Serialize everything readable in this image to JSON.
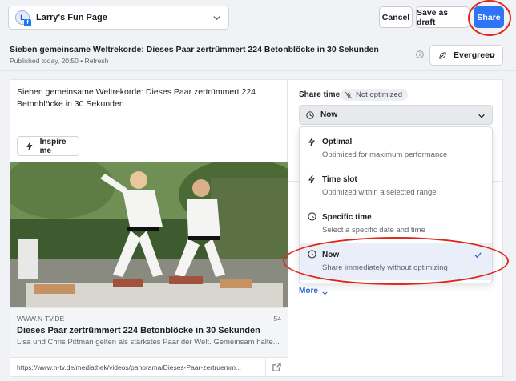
{
  "header": {
    "page_name": "Larry's Fun Page",
    "avatar_letter": "L",
    "cancel_label": "Cancel",
    "draft_label": "Save as draft",
    "share_label": "Share"
  },
  "post": {
    "title": "Sieben gemeinsame Weltrekorde: Dieses Paar zertrümmert 224 Betonblöcke in 30 Sekunden",
    "meta": "Published today, 20:50 • Refresh",
    "evergreen_label": "Evergreen",
    "body_text": "Sieben gemeinsame Weltrekorde: Dieses Paar zertrümmert 224 Betonblöcke in 30 Sekunden",
    "inspire_label": "Inspire me"
  },
  "link_card": {
    "domain": "WWW.N-TV.DE",
    "count": "54",
    "title": "Dieses Paar zertrümmert 224 Betonblöcke in 30 Sekunden",
    "description": "Lisa und Chris Pittman gelten als stärkstes Paar der Welt. Gemeinsam halte...",
    "url": "https://www.n-tv.de/mediathek/videos/panorama/Dieses-Paar-zertruemm..."
  },
  "share_time": {
    "label": "Share time",
    "badge": "Not optimized",
    "selected": "Now",
    "options": [
      {
        "title": "Optimal",
        "desc": "Optimized for maximum performance",
        "icon": "bolt-icon"
      },
      {
        "title": "Time slot",
        "desc": "Optimized within a selected range",
        "icon": "bolt-icon"
      },
      {
        "title": "Specific time",
        "desc": "Select a specific date and time",
        "icon": "clock-icon"
      },
      {
        "title": "Now",
        "desc": "Share immediately without optimizing",
        "icon": "clock-icon",
        "selected": true
      }
    ],
    "more_label": "More"
  },
  "colors": {
    "accent": "#2f74f5",
    "annotation": "#e0281a",
    "link": "#2a62d4"
  }
}
